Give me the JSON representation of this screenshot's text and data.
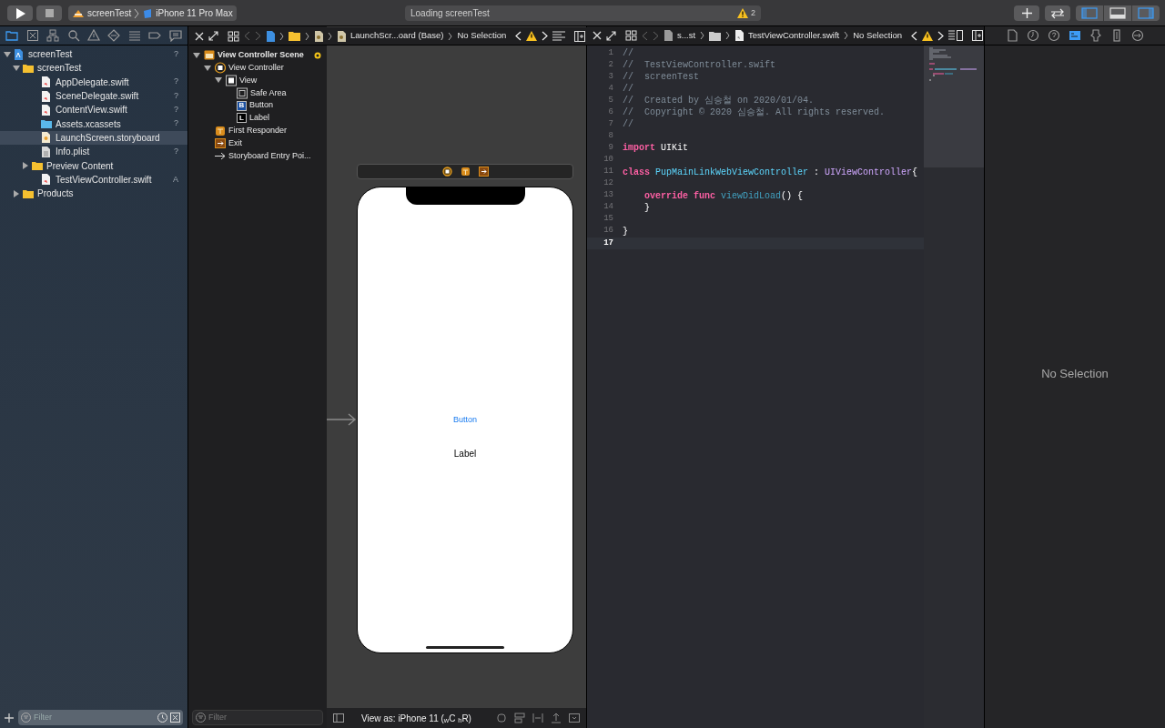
{
  "toolbar": {
    "scheme": "screenTest",
    "destination": "iPhone 11 Pro Max",
    "activity": "Loading screenTest",
    "warning_count": "2"
  },
  "navigator": {
    "tabs": [
      {
        "kind": "folder",
        "selected": true
      },
      {
        "kind": "xbox",
        "selected": false
      },
      {
        "kind": "hierarchy",
        "selected": false
      },
      {
        "kind": "search",
        "selected": false
      },
      {
        "kind": "warning",
        "selected": false
      },
      {
        "kind": "diamond",
        "selected": false
      },
      {
        "kind": "list",
        "selected": false
      },
      {
        "kind": "tag",
        "selected": false
      },
      {
        "kind": "chat",
        "selected": false
      }
    ],
    "tree": [
      {
        "label": "screenTest",
        "kind": "project",
        "badge": "?",
        "selected": false,
        "expanded": true,
        "children": [
          {
            "label": "screenTest",
            "kind": "folder",
            "selected": false,
            "expanded": true,
            "children": [
              {
                "label": "AppDelegate.swift",
                "kind": "swift",
                "badge": "?",
                "selected": false
              },
              {
                "label": "SceneDelegate.swift",
                "kind": "swift",
                "badge": "?",
                "selected": false
              },
              {
                "label": "ContentView.swift",
                "kind": "swift",
                "badge": "?",
                "selected": false
              },
              {
                "label": "Assets.xcassets",
                "kind": "assets",
                "badge": "?",
                "selected": false
              },
              {
                "label": "LaunchScreen.storyboard",
                "kind": "storyboard",
                "selected": true
              },
              {
                "label": "Info.plist",
                "kind": "plist",
                "badge": "?",
                "selected": false
              },
              {
                "label": "Preview Content",
                "kind": "folder",
                "selected": false,
                "expanded": false
              },
              {
                "label": "TestViewController.swift",
                "kind": "swift",
                "badge": "A",
                "selected": false
              }
            ]
          },
          {
            "label": "Products",
            "kind": "folder",
            "selected": false,
            "expanded": false
          }
        ]
      }
    ],
    "filter": {
      "placeholder": "Filter"
    }
  },
  "storyboard": {
    "jump_bar": {
      "file": "LaunchScr...oard (Base)",
      "selection": "No Selection"
    },
    "outline": [
      {
        "label": "View Controller Scene",
        "kind": "scene",
        "expanded": true,
        "children": [
          {
            "label": "View Controller",
            "kind": "controller",
            "expanded": true,
            "children": [
              {
                "label": "View",
                "kind": "view",
                "expanded": true,
                "children": [
                  {
                    "label": "Safe Area",
                    "kind": "safearea"
                  },
                  {
                    "label": "Button",
                    "kind": "button",
                    "glyph": "B"
                  },
                  {
                    "label": "Label",
                    "kind": "label",
                    "glyph": "L"
                  }
                ]
              }
            ]
          },
          {
            "label": "First Responder",
            "kind": "responder"
          },
          {
            "label": "Exit",
            "kind": "exit"
          },
          {
            "label": "Storyboard Entry Poi...",
            "kind": "entry"
          }
        ]
      }
    ],
    "filter": {
      "placeholder": "Filter"
    },
    "canvas": {
      "button": "Button",
      "label": "Label"
    },
    "view_as": "View as: iPhone 11 ($_{w}$C $_{h}$R)"
  },
  "editor": {
    "jump_bar": {
      "group": "s...st",
      "file": "TestViewController.swift",
      "selection": "No Selection"
    },
    "lines": [
      {
        "number": "1",
        "current": false,
        "tokens": [
          {
            "kind": "comment",
            "text": "//"
          }
        ]
      },
      {
        "number": "2",
        "current": false,
        "tokens": [
          {
            "kind": "comment",
            "text": "//  TestViewController.swift"
          }
        ]
      },
      {
        "number": "3",
        "current": false,
        "tokens": [
          {
            "kind": "comment",
            "text": "//  screenTest"
          }
        ]
      },
      {
        "number": "4",
        "current": false,
        "tokens": [
          {
            "kind": "comment",
            "text": "//"
          }
        ]
      },
      {
        "number": "5",
        "current": false,
        "tokens": [
          {
            "kind": "comment",
            "text": "//  Created by 심승철 on 2020/01/04."
          }
        ]
      },
      {
        "number": "6",
        "current": false,
        "tokens": [
          {
            "kind": "comment",
            "text": "//  Copyright © 2020 심승철. All rights reserved."
          }
        ]
      },
      {
        "number": "7",
        "current": false,
        "tokens": [
          {
            "kind": "comment",
            "text": "//"
          }
        ]
      },
      {
        "number": "8",
        "current": false
      },
      {
        "number": "9",
        "current": false,
        "tokens": [
          {
            "kind": "keyword",
            "text": "import "
          },
          {
            "kind": "plain",
            "text": "UIKit"
          }
        ]
      },
      {
        "number": "10",
        "current": false
      },
      {
        "number": "11",
        "current": false,
        "tokens": [
          {
            "kind": "keyword",
            "text": "class "
          },
          {
            "kind": "declaration",
            "text": "PupMainLinkWebViewController"
          },
          {
            "kind": "plain",
            "text": " : "
          },
          {
            "kind": "type",
            "text": "UIViewController"
          },
          {
            "kind": "plain",
            "text": "{"
          }
        ]
      },
      {
        "number": "12",
        "current": false
      },
      {
        "number": "13",
        "current": false,
        "tokens": [
          {
            "kind": "keyword",
            "text": "    override func "
          },
          {
            "kind": "function",
            "text": "viewDidLoad"
          },
          {
            "kind": "plain",
            "text": "() {"
          }
        ]
      },
      {
        "number": "14",
        "current": false,
        "tokens": [
          {
            "kind": "plain",
            "text": "    }"
          }
        ]
      },
      {
        "number": "15",
        "current": false
      },
      {
        "number": "16",
        "current": false,
        "tokens": [
          {
            "kind": "plain",
            "text": "}"
          }
        ]
      },
      {
        "number": "17",
        "current": true
      }
    ]
  },
  "inspector": {
    "tabs": [
      {
        "kind": "file",
        "selected": false
      },
      {
        "kind": "clock",
        "selected": false
      },
      {
        "kind": "help",
        "selected": false
      },
      {
        "kind": "identity",
        "selected": true
      },
      {
        "kind": "attributes",
        "selected": false
      },
      {
        "kind": "size",
        "selected": false
      },
      {
        "kind": "connections",
        "selected": false
      }
    ],
    "empty_text": "No Selection"
  }
}
